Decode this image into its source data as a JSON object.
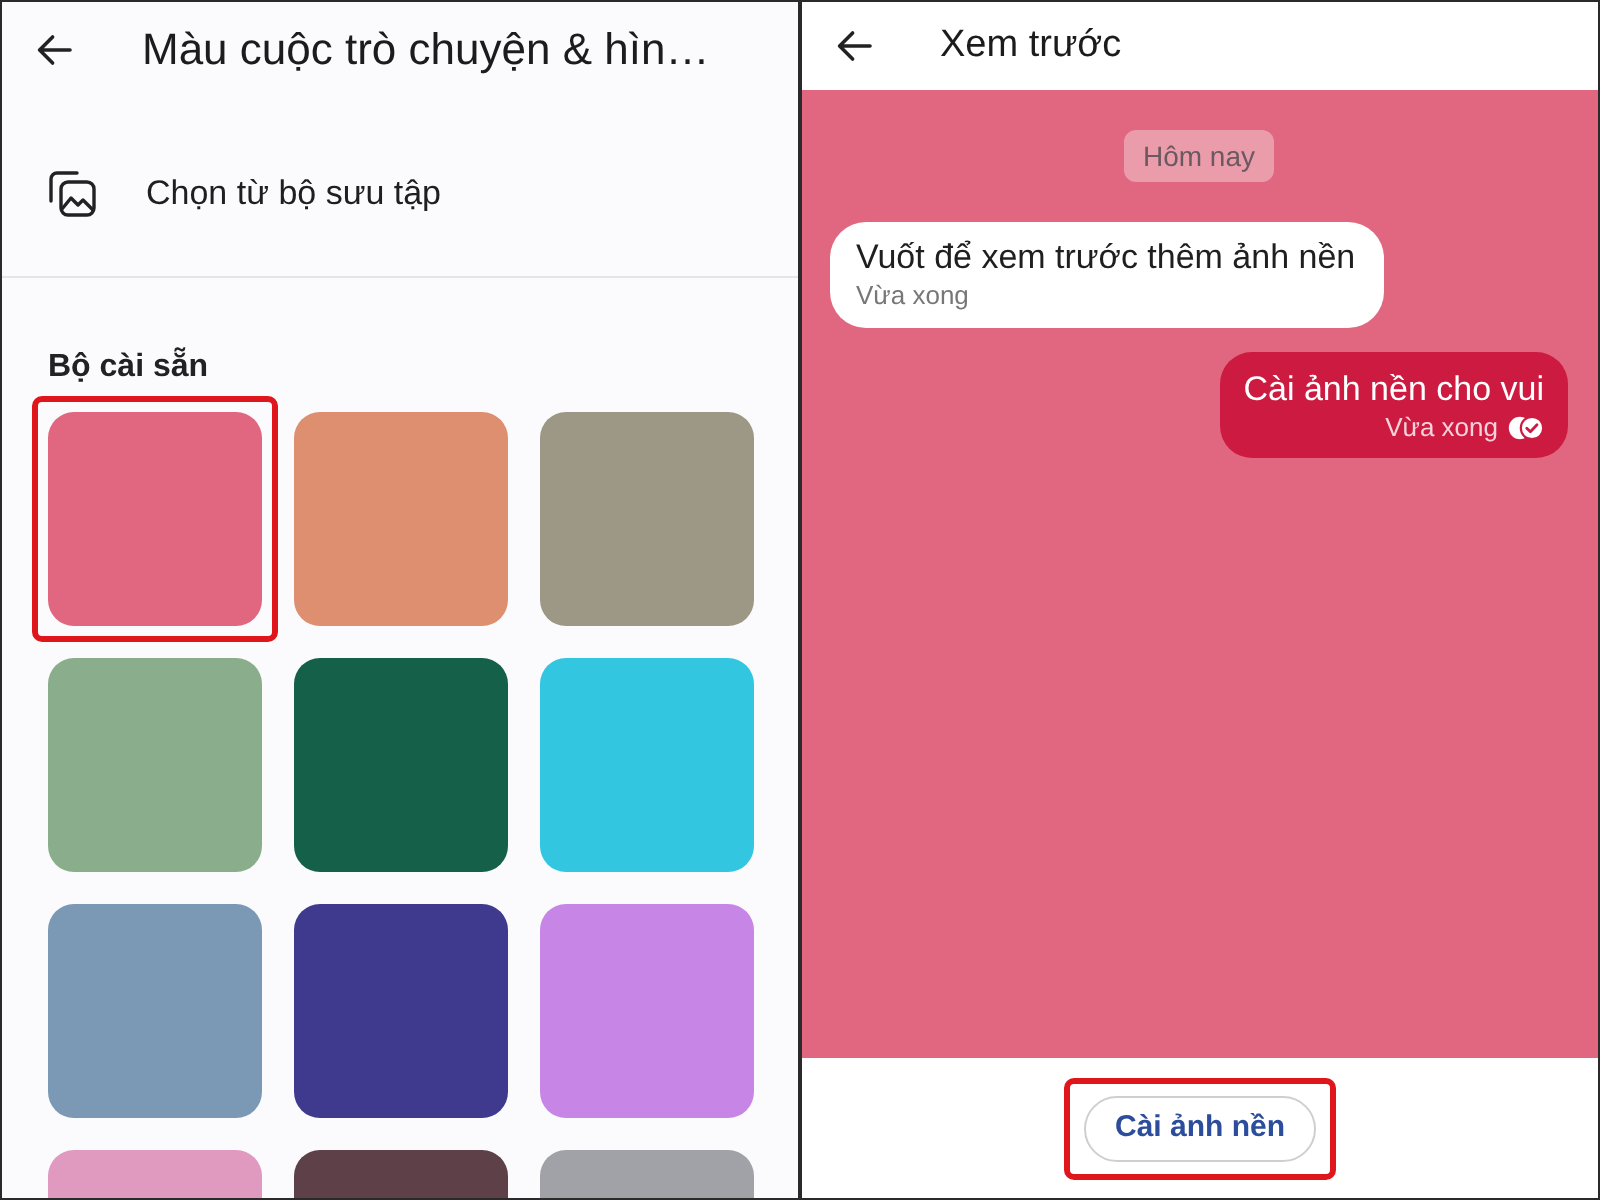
{
  "settings_screen": {
    "title": "Màu cuộc trò chuyện & hìn…",
    "gallery_option": {
      "label": "Chọn từ bộ sưu tập"
    },
    "presets": {
      "heading": "Bộ cài sẵn",
      "swatches": [
        {
          "color": "#e0677f",
          "selected": true
        },
        {
          "color": "#de8f70",
          "selected": false
        },
        {
          "color": "#9d9785",
          "selected": false
        },
        {
          "color": "#8aae8c",
          "selected": false
        },
        {
          "color": "#156048",
          "selected": false
        },
        {
          "color": "#33c6e0",
          "selected": false
        },
        {
          "color": "#7b99b5",
          "selected": false
        },
        {
          "color": "#3f3a8d",
          "selected": false
        },
        {
          "color": "#c786e6",
          "selected": false
        },
        {
          "color": "#e09abf",
          "selected": false
        },
        {
          "color": "#5e4048",
          "selected": false
        },
        {
          "color": "#a1a1a8",
          "selected": false
        }
      ]
    }
  },
  "preview_screen": {
    "title": "Xem trước",
    "date_chip": "Hôm nay",
    "messages": [
      {
        "kind": "incoming",
        "text": "Vuốt để xem trước thêm ảnh nền",
        "time": "Vừa xong"
      },
      {
        "kind": "outgoing",
        "text": "Cài ảnh nền cho vui",
        "time": "Vừa xong"
      }
    ],
    "set_button": {
      "label": "Cài ảnh nền",
      "highlighted": true
    }
  }
}
